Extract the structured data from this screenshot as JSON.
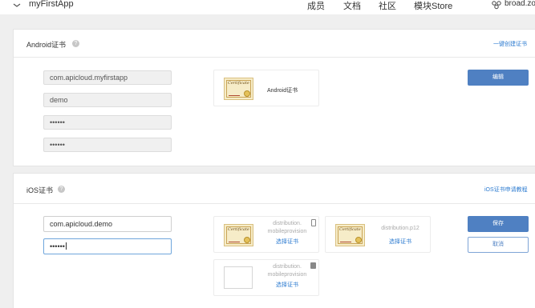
{
  "topbar": {
    "app_name": "myFirstApp",
    "nav": [
      "成员",
      "文档",
      "社区",
      "模块Store"
    ],
    "user_name": "broad.zo"
  },
  "android": {
    "title": "Android证书",
    "help": "?",
    "link": "一键创建证书",
    "fields": [
      "com.apicloud.myfirstapp",
      "demo",
      "••••••",
      "••••••"
    ],
    "cert": {
      "name": "Android证书",
      "image_text": "Certificate"
    },
    "button": "编辑"
  },
  "ios": {
    "title": "iOS证书",
    "help": "?",
    "link": "iOS证书申请教程",
    "bundle_id": "com.apicloud.demo",
    "password": "••••••",
    "certs": [
      {
        "file_line1": "distribution.",
        "file_line2": "mobileprovision",
        "select": "选择证书",
        "image_text": "Certificate",
        "device": "phone-icon"
      },
      {
        "file_line1": "distribution.p12",
        "select": "选择证书",
        "image_text": "Certificate"
      },
      {
        "file_line1": "distribution.",
        "file_line2": "mobileprovision",
        "select": "选择证书",
        "device": "tablet-icon"
      }
    ],
    "save": "保存",
    "cancel": "取消"
  },
  "colors": {
    "accent": "#4f80c2",
    "link": "#2c7bd0",
    "background": "#efefef"
  }
}
